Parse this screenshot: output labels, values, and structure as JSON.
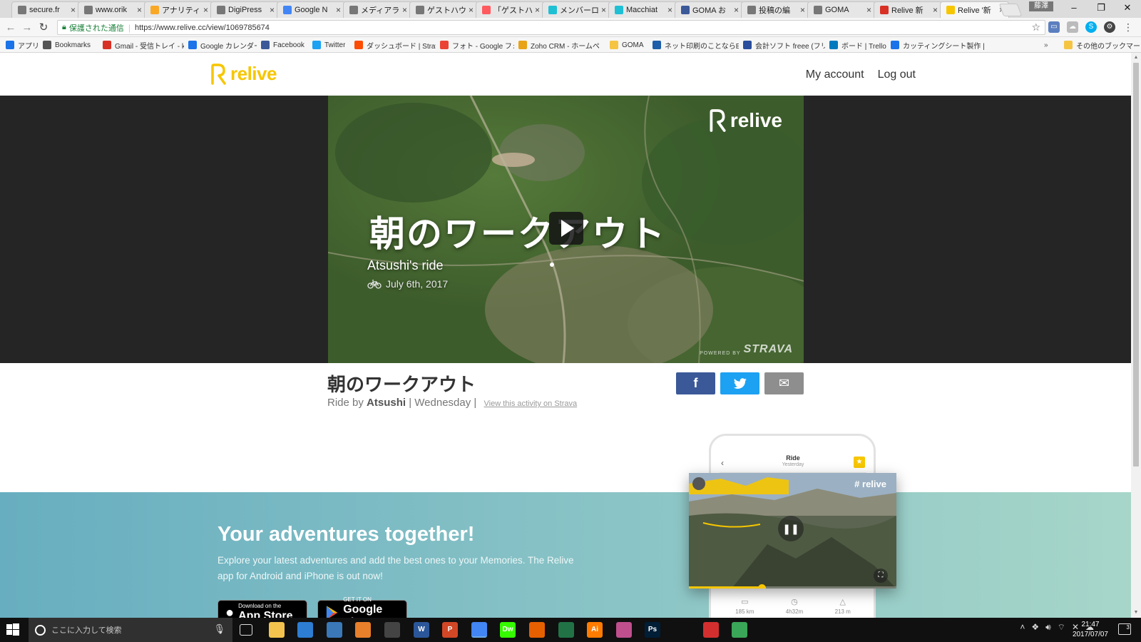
{
  "browser": {
    "tabs": [
      {
        "label": "secure.fr",
        "icon": "back-arrow-icon",
        "color": "#777777"
      },
      {
        "label": "www.orik",
        "icon": "page-icon",
        "color": "#777777"
      },
      {
        "label": "アナリティ",
        "icon": "analytics-icon",
        "color": "#f9a825"
      },
      {
        "label": "DigiPress",
        "icon": "page-icon",
        "color": "#777777"
      },
      {
        "label": "Google N",
        "icon": "google-icon",
        "color": "#4285f4"
      },
      {
        "label": "メディアラ",
        "icon": "page-icon",
        "color": "#777777"
      },
      {
        "label": "ゲストハウ",
        "icon": "page-icon",
        "color": "#777777"
      },
      {
        "label": "「ゲストハ",
        "icon": "airbnb-icon",
        "color": "#ff5a5f"
      },
      {
        "label": "メンバーロ",
        "icon": "d-icon",
        "color": "#1fc0d4"
      },
      {
        "label": "Macchiat",
        "icon": "d-icon",
        "color": "#1fc0d4"
      },
      {
        "label": "GOMA お",
        "icon": "facebook-icon",
        "color": "#3b5998"
      },
      {
        "label": "投稿の編",
        "icon": "page-icon",
        "color": "#777777"
      },
      {
        "label": "GOMA",
        "icon": "page-icon",
        "color": "#777777"
      },
      {
        "label": "Relive 新",
        "icon": "gmail-icon",
        "color": "#d93025"
      },
      {
        "label": "Relive '新",
        "icon": "relive-icon",
        "color": "#f7c600"
      }
    ],
    "ime_indicator": "藤澤",
    "secure_label": "保護された通信",
    "url": "https://www.relive.cc/view/1069785674",
    "bookmarks": [
      {
        "label": "アプリ",
        "icon": "apps-grid-icon",
        "color": "#1a73e8"
      },
      {
        "label": "Bookmarks",
        "icon": "star-icon",
        "color": "#555555"
      },
      {
        "label": "Gmail - 受信トレイ - k",
        "icon": "gmail-icon",
        "color": "#d93025"
      },
      {
        "label": "Google カレンダー",
        "icon": "calendar-icon",
        "color": "#1a73e8"
      },
      {
        "label": "Facebook",
        "icon": "facebook-icon",
        "color": "#3b5998"
      },
      {
        "label": "Twitter",
        "icon": "twitter-icon",
        "color": "#1da1f2"
      },
      {
        "label": "ダッシュボード | Strava",
        "icon": "strava-icon",
        "color": "#fc4c02"
      },
      {
        "label": "フォト - Google フォト",
        "icon": "photos-icon",
        "color": "#ea4335"
      },
      {
        "label": "Zoho CRM - ホームペ",
        "icon": "zoho-icon",
        "color": "#e8a317"
      },
      {
        "label": "GOMA",
        "icon": "folder-icon",
        "color": "#f5c542"
      },
      {
        "label": "ネット印刷のことならE",
        "icon": "print-icon",
        "color": "#1f5ea8"
      },
      {
        "label": "会計ソフト freee (フリー",
        "icon": "freee-icon",
        "color": "#2a4e9c"
      },
      {
        "label": "ボード | Trello",
        "icon": "trello-icon",
        "color": "#0079bf"
      },
      {
        "label": "カッティングシート製作 |",
        "icon": "search-icon",
        "color": "#1a73e8"
      }
    ],
    "more_bookmarks_label": "»",
    "other_bookmarks": "その他のブックマーク"
  },
  "site": {
    "brand": "relive",
    "nav": {
      "my_account": "My account",
      "log_out": "Log out"
    },
    "video": {
      "title": "朝のワークアウト",
      "subtitle": "Atsushi's ride",
      "date": "July 6th, 2017",
      "watermark": "relive",
      "powered_by": "POWERED BY",
      "powered_brand": "STRAVA"
    },
    "activity": {
      "title": "朝のワークアウト",
      "ride_by": "Ride by",
      "athlete": "Atsushi",
      "day": "Wednesday",
      "strava_link": "View this activity on Strava"
    },
    "share": {
      "facebook": "f",
      "twitter": "t",
      "email": "✉"
    },
    "promo": {
      "title": "Your adventures together!",
      "text": "Explore your latest adventures and add the best ones to your Memories. The Relive app for Android and iPhone is out now!",
      "appstore_small": "Download on the",
      "appstore_big": "App Store",
      "googleplay_small": "GET IT ON",
      "googleplay_big": "Google Play"
    },
    "phone": {
      "header_title": "Ride",
      "header_sub": "Yesterday",
      "hashtag": "# relive",
      "progress": 0.35,
      "stats": [
        {
          "icon": "distance-icon",
          "value": "185 km"
        },
        {
          "icon": "timer-icon",
          "value": "4h32m"
        },
        {
          "icon": "elevation-icon",
          "value": "213 m"
        }
      ]
    }
  },
  "taskbar": {
    "search_placeholder": "ここに入力して検索",
    "clock_time": "21:47",
    "clock_date": "2017/07/07",
    "notification_count": "3",
    "apps": [
      {
        "name": "task-view",
        "label": "",
        "color": "#101010"
      },
      {
        "name": "file-explorer",
        "label": "",
        "color": "#f3c34e"
      },
      {
        "name": "store",
        "label": "",
        "color": "#2d7dd2"
      },
      {
        "name": "thunderbird",
        "label": "",
        "color": "#3a78b8"
      },
      {
        "name": "media-player",
        "label": "",
        "color": "#e87f2a"
      },
      {
        "name": "calculator",
        "label": "",
        "color": "#444444"
      },
      {
        "name": "word",
        "label": "W",
        "color": "#2b579a"
      },
      {
        "name": "powerpoint",
        "label": "P",
        "color": "#d24726"
      },
      {
        "name": "chrome",
        "label": "",
        "color": "#4285f4"
      },
      {
        "name": "dreamweaver",
        "label": "Dw",
        "color": "#35fa00"
      },
      {
        "name": "firefox",
        "label": "",
        "color": "#e66000"
      },
      {
        "name": "excel",
        "label": "",
        "color": "#217346"
      },
      {
        "name": "illustrator",
        "label": "Ai",
        "color": "#ff7c00"
      },
      {
        "name": "app-grid",
        "label": "",
        "color": "#c04f8e"
      },
      {
        "name": "photoshop",
        "label": "Ps",
        "color": "#001e36"
      },
      {
        "name": "movie-maker",
        "label": "",
        "color": "#101010"
      },
      {
        "name": "app-red",
        "label": "",
        "color": "#d32f2f"
      },
      {
        "name": "network-app",
        "label": "",
        "color": "#3aa657"
      }
    ]
  }
}
